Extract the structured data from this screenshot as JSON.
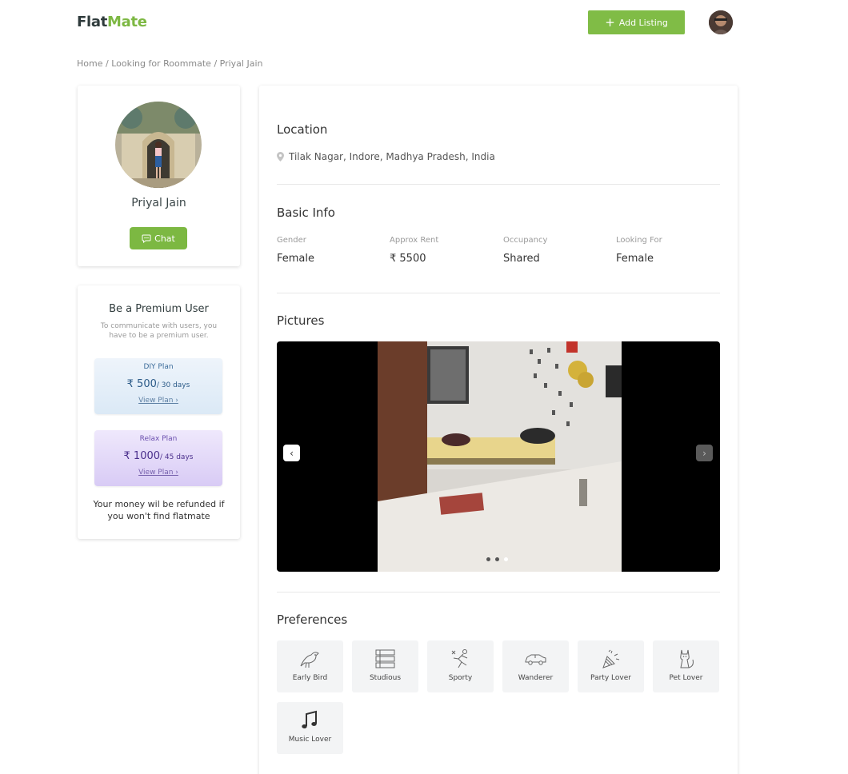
{
  "header": {
    "logo_part1": "Flat",
    "logo_part2": "Mate",
    "add_listing_label": "Add Listing"
  },
  "breadcrumb": [
    "Home",
    "Looking for Roommate",
    "Priyal Jain"
  ],
  "profile": {
    "name": "Priyal Jain",
    "chat_label": "Chat"
  },
  "premium": {
    "title": "Be a Premium User",
    "subtitle": "To communicate with users, you have to be a premium user.",
    "plans": [
      {
        "name": "DIY Plan",
        "price": "₹ 500",
        "period": "/ 30 days",
        "link": "View Plan ›"
      },
      {
        "name": "Relax Plan",
        "price": "₹ 1000",
        "period": "/ 45 days",
        "link": "View Plan ›"
      }
    ],
    "refund_note": "Your money wil be refunded if you won't find flatmate"
  },
  "location": {
    "title": "Location",
    "address": "Tilak Nagar, Indore, Madhya Pradesh, India"
  },
  "basic_info": {
    "title": "Basic Info",
    "fields": [
      {
        "label": "Gender",
        "value": "Female"
      },
      {
        "label": "Approx Rent",
        "value": "₹ 5500"
      },
      {
        "label": "Occupancy",
        "value": "Shared"
      },
      {
        "label": "Looking For",
        "value": "Female"
      }
    ]
  },
  "pictures": {
    "title": "Pictures",
    "slide_count": 3,
    "active_slide": 3
  },
  "preferences": {
    "title": "Preferences",
    "items": [
      {
        "label": "Early Bird",
        "icon": "bird-icon"
      },
      {
        "label": "Studious",
        "icon": "books-icon"
      },
      {
        "label": "Sporty",
        "icon": "sporty-icon"
      },
      {
        "label": "Wanderer",
        "icon": "car-icon"
      },
      {
        "label": "Party Lover",
        "icon": "party-popper-icon"
      },
      {
        "label": "Pet Lover",
        "icon": "cat-icon"
      },
      {
        "label": "Music Lover",
        "icon": "music-note-icon"
      }
    ]
  },
  "colors": {
    "brand_green": "#80bc46",
    "logo_dark": "#2f3b3c"
  }
}
